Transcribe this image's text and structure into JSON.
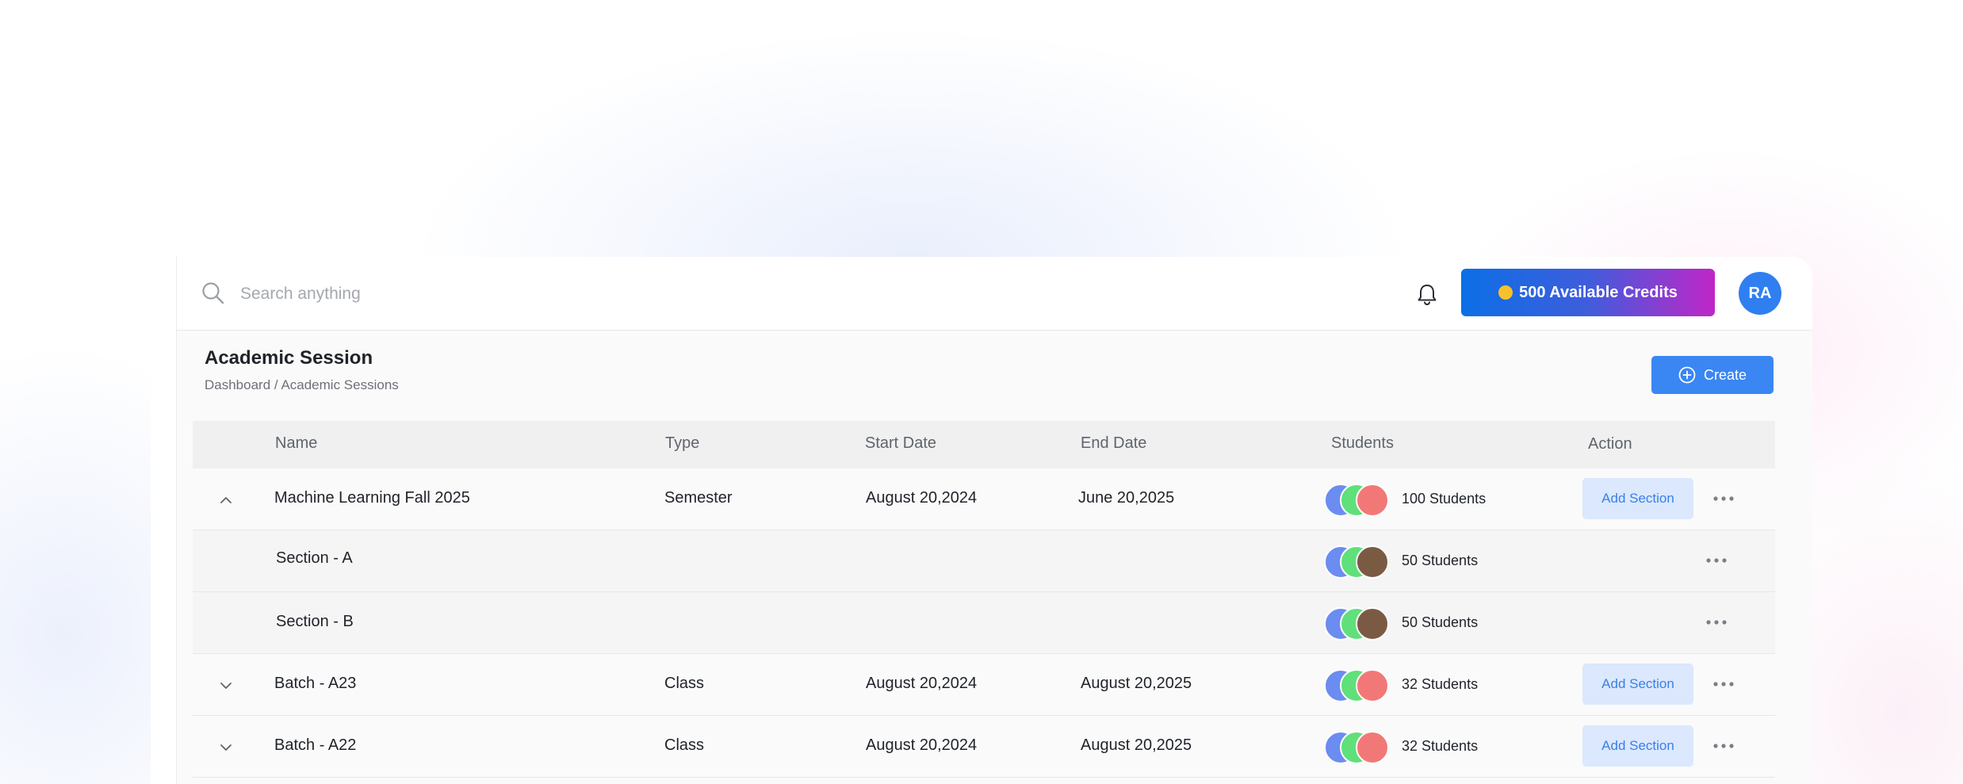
{
  "search": {
    "placeholder": "Search anything"
  },
  "header": {
    "credits_label": "500 Available Credits",
    "avatar_initials": "RA"
  },
  "page": {
    "title": "Academic Session",
    "breadcrumb": [
      "Dashboard",
      "/",
      "Academic Sessions"
    ],
    "create_label": "Create"
  },
  "table": {
    "columns": [
      "Name",
      "Type",
      "Start Date",
      "End Date",
      "Students",
      "Action"
    ],
    "rows": [
      {
        "name": "Machine Learning Fall 2025",
        "type": "Semester",
        "start": "August 20,2024",
        "end": "June 20,2025",
        "students": "100 Students",
        "action": "Add Section",
        "expanded": true
      },
      {
        "name": "Section - A",
        "students": "50 Students",
        "sub": true
      },
      {
        "name": "Section - B",
        "students": "50 Students",
        "sub": true
      },
      {
        "name": "Batch - A23",
        "type": "Class",
        "start": "August 20,2024",
        "end": "August 20,2025",
        "students": "32 Students",
        "action": "Add Section",
        "expanded": false
      },
      {
        "name": "Batch - A22",
        "type": "Class",
        "start": "August 20,2024",
        "end": "August 20,2025",
        "students": "32 Students",
        "action": "Add Section",
        "expanded": false
      }
    ]
  },
  "colors": {
    "primary": "#3a86f2",
    "credits_start": "#0b6fe6",
    "credits_end": "#c026c7",
    "add_section_bg": "#dbe8fd"
  },
  "icons": {
    "search": "search-icon",
    "bell": "bell-icon",
    "expand": "chevron-down-icon",
    "collapse": "chevron-up-icon",
    "more": "more-horizontal-icon",
    "create": "plus-circle-icon"
  }
}
